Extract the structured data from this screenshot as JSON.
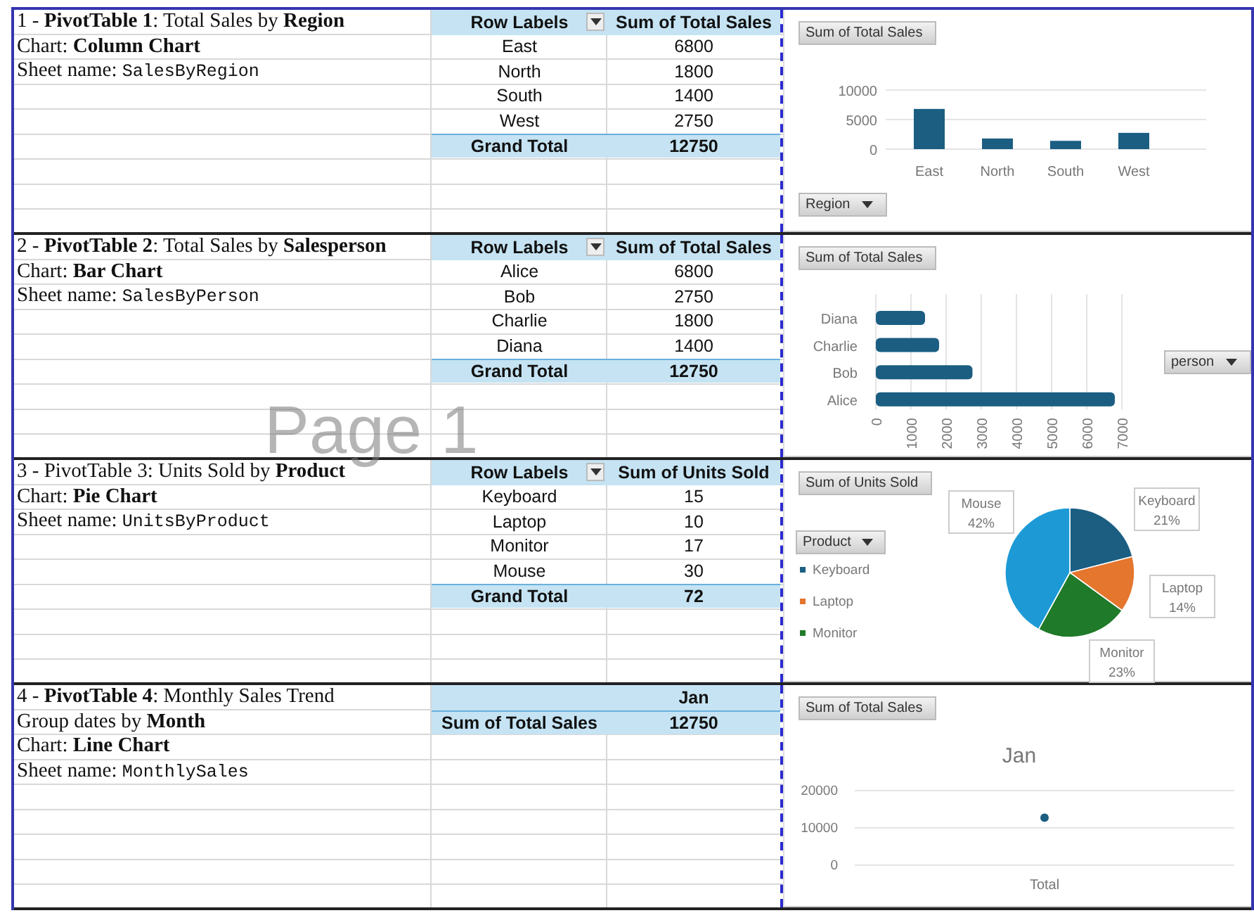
{
  "watermark_label": "Page 1",
  "sections": [
    {
      "lines": [
        {
          "kind": "text",
          "text": "1 - **PivotTable 1**: Total Sales by **Region**"
        },
        {
          "kind": "text",
          "text": "Chart: **Column Chart**"
        },
        {
          "kind": "sheet",
          "label": "Sheet name:",
          "value": "SalesByRegion"
        }
      ],
      "pivot": {
        "kind": "rows",
        "header": [
          "Row Labels",
          "Sum of Total Sales"
        ],
        "rows": [
          [
            "East",
            "6800"
          ],
          [
            "North",
            "1800"
          ],
          [
            "South",
            "1400"
          ],
          [
            "West",
            "2750"
          ]
        ],
        "total": [
          "Grand Total",
          "12750"
        ]
      },
      "chart": {
        "filter_button": "Region",
        "chart_data": {
          "type": "bar",
          "orientation": "vertical",
          "categories": [
            "East",
            "North",
            "South",
            "West"
          ],
          "series": [
            {
              "name": "Sum of Total Sales",
              "color": "#1b5e82",
              "values": [
                6800,
                1800,
                1400,
                2750
              ]
            }
          ],
          "grid": true,
          "ylim": [
            0,
            10000
          ],
          "yticks": [
            0,
            5000,
            10000
          ]
        }
      }
    },
    {
      "lines": [
        {
          "kind": "text",
          "text": "2 - **PivotTable 2**: Total Sales by **Salesperson**"
        },
        {
          "kind": "text",
          "text": "Chart: **Bar Chart**"
        },
        {
          "kind": "sheet",
          "label": "Sheet name:",
          "value": "SalesByPerson"
        }
      ],
      "pivot": {
        "kind": "rows",
        "header": [
          "Row Labels",
          "Sum of Total Sales"
        ],
        "rows": [
          [
            "Alice",
            "6800"
          ],
          [
            "Bob",
            "2750"
          ],
          [
            "Charlie",
            "1800"
          ],
          [
            "Diana",
            "1400"
          ]
        ],
        "total": [
          "Grand Total",
          "12750"
        ]
      },
      "chart": {
        "filter_button": "person",
        "chart_data": {
          "type": "bar",
          "orientation": "horizontal",
          "categories": [
            "Diana",
            "Charlie",
            "Bob",
            "Alice"
          ],
          "series": [
            {
              "name": "Sum of Total Sales",
              "color": "#1b5e82",
              "values": [
                1400,
                1800,
                2750,
                6800
              ]
            }
          ],
          "grid": true,
          "xlim": [
            0,
            7000
          ],
          "xticks": [
            0,
            1000,
            2000,
            3000,
            4000,
            5000,
            6000,
            7000
          ]
        }
      }
    },
    {
      "lines": [
        {
          "kind": "text",
          "text": "3 - PivotTable 3: Units Sold by **Product**"
        },
        {
          "kind": "text",
          "text": "Chart: **Pie Chart**"
        },
        {
          "kind": "sheet",
          "label": "Sheet name:",
          "value": "UnitsByProduct"
        }
      ],
      "pivot": {
        "kind": "rows",
        "header": [
          "Row Labels",
          "Sum of Units Sold"
        ],
        "rows": [
          [
            "Keyboard",
            "15"
          ],
          [
            "Laptop",
            "10"
          ],
          [
            "Monitor",
            "17"
          ],
          [
            "Mouse",
            "30"
          ]
        ],
        "total": [
          "Grand Total",
          "72"
        ]
      },
      "chart": {
        "filter_button": "Product",
        "legend": [
          "Keyboard",
          "Laptop",
          "Monitor"
        ],
        "chart_data": {
          "type": "pie",
          "categories": [
            "Keyboard",
            "Laptop",
            "Monitor",
            "Mouse"
          ],
          "colors": [
            "#1b5e82",
            "#e4762e",
            "#1f7a2a",
            "#1d9ad6"
          ],
          "series": [
            {
              "name": "Sum of Units Sold",
              "values": [
                21,
                14,
                23,
                42
              ]
            }
          ],
          "value_labels": [
            "21%",
            "14%",
            "23%",
            "42%"
          ]
        }
      }
    },
    {
      "lines": [
        {
          "kind": "text",
          "text": "4 - **PivotTable 4**: Monthly Sales Trend"
        },
        {
          "kind": "text",
          "text": "Group dates by **Month**"
        },
        {
          "kind": "text",
          "text": "Chart: **Line Chart**"
        },
        {
          "kind": "sheet",
          "label": "Sheet name:",
          "value": "MonthlySales"
        }
      ],
      "pivot": {
        "kind": "columns",
        "column_label": "Jan",
        "row": [
          "Sum of Total Sales",
          "12750"
        ]
      },
      "chart": {
        "chart_data": {
          "type": "line",
          "title": "Jan",
          "categories": [
            "Total"
          ],
          "series": [
            {
              "name": "Sum of Total Sales",
              "color": "#1b5e82",
              "marker": "circle",
              "values": [
                12750
              ]
            }
          ],
          "grid": true,
          "ylim": [
            0,
            20000
          ],
          "yticks": [
            0,
            10000,
            20000
          ]
        }
      }
    }
  ]
}
